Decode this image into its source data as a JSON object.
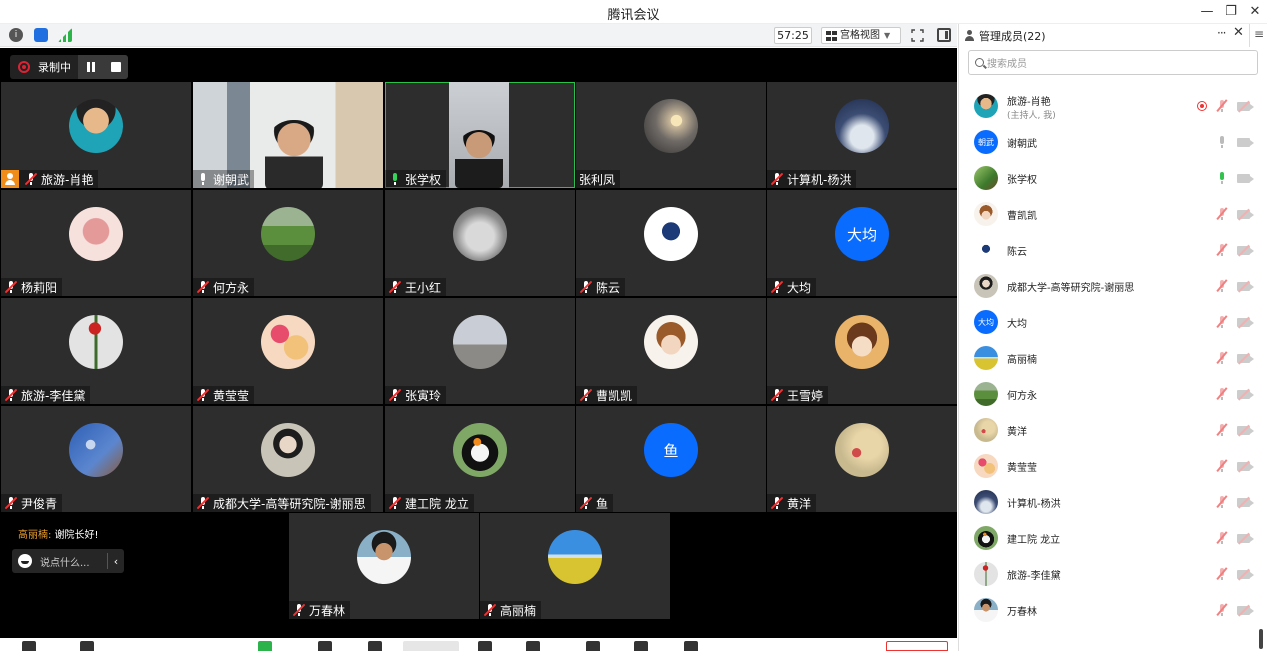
{
  "window": {
    "title": "腾讯会议"
  },
  "toolbar": {
    "timer": "57:25",
    "view_label": "宫格视图"
  },
  "recording": {
    "label": "录制中"
  },
  "tiles": [
    {
      "name": "旅游-肖艳",
      "host": true
    },
    {
      "name": "谢朝武",
      "mic": "on-white",
      "video": true
    },
    {
      "name": "张学权",
      "mic": "on",
      "video": true,
      "active": true
    },
    {
      "name": "张利凤",
      "mic": "none"
    },
    {
      "name": "计算机-杨洪"
    },
    {
      "name": "杨莉阳"
    },
    {
      "name": "何方永"
    },
    {
      "name": "王小红"
    },
    {
      "name": "陈云"
    },
    {
      "name": "大均",
      "avatar_text": "大均"
    },
    {
      "name": "旅游-李佳黛"
    },
    {
      "name": "黄莹莹"
    },
    {
      "name": "张寅玲"
    },
    {
      "name": "曹凯凯"
    },
    {
      "name": "王雪婷"
    },
    {
      "name": "尹俊青"
    },
    {
      "name": "成都大学-高等研究院-谢丽思"
    },
    {
      "name": "建工院 龙立"
    },
    {
      "name": "鱼",
      "avatar_text": "鱼"
    },
    {
      "name": "黄洋"
    },
    {
      "name": "万春林"
    },
    {
      "name": "高丽楠"
    }
  ],
  "chat": {
    "sender": "高丽楠:",
    "message": "谢院长好!",
    "input_placeholder": "说点什么..."
  },
  "panel": {
    "title": "管理成员(22)",
    "search_placeholder": "搜索成员",
    "members": [
      {
        "name": "旅游-肖艳",
        "sub": "(主持人, 我)",
        "recording": true,
        "mic": "muted"
      },
      {
        "name": "谢朝武",
        "avatar_text": "朝武",
        "mic": "on-gray"
      },
      {
        "name": "张学权",
        "mic": "on"
      },
      {
        "name": "曹凯凯",
        "mic": "muted"
      },
      {
        "name": "陈云",
        "mic": "muted"
      },
      {
        "name": "成都大学-高等研究院-谢丽思",
        "mic": "muted"
      },
      {
        "name": "大均",
        "avatar_text": "大均",
        "mic": "muted"
      },
      {
        "name": "高丽楠",
        "mic": "muted"
      },
      {
        "name": "何方永",
        "mic": "muted"
      },
      {
        "name": "黄洋",
        "mic": "muted"
      },
      {
        "name": "黄莹莹",
        "mic": "muted"
      },
      {
        "name": "计算机-杨洪",
        "mic": "muted"
      },
      {
        "name": "建工院 龙立",
        "mic": "muted"
      },
      {
        "name": "旅游-李佳黛",
        "mic": "muted"
      },
      {
        "name": "万春林",
        "mic": "muted"
      }
    ]
  },
  "colors": {
    "accent": "#0a6cff",
    "speaking": "#33c24d",
    "muted": "#e33333",
    "host_badge": "#f08c1a"
  }
}
